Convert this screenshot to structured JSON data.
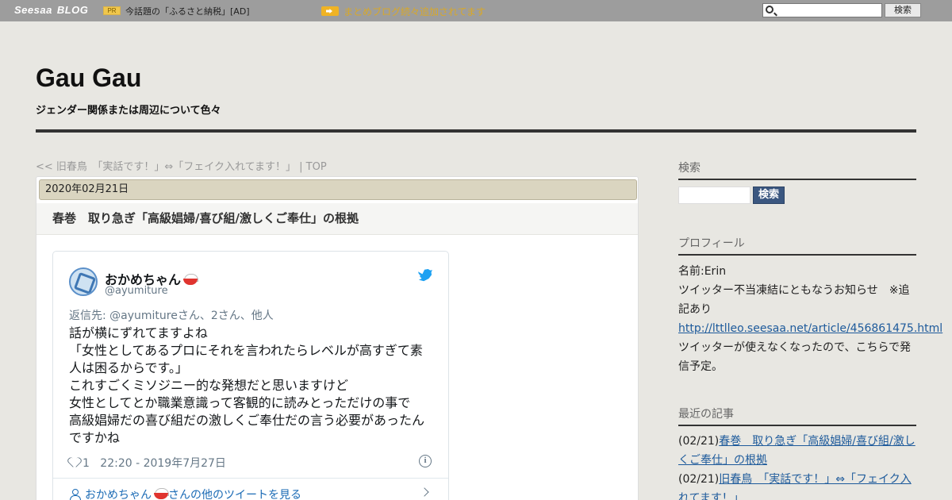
{
  "topbar": {
    "logo_seesaa": "Seesaa",
    "logo_blog": "BLOG",
    "pr_badge": "PR",
    "pr_text": "今話題の「ふるさと納税」[AD]",
    "news_text": "まとめブログ続々追加されてます",
    "search_value": "",
    "search_button": "検索"
  },
  "header": {
    "title": "Gau Gau",
    "description": "ジェンダー関係または周辺について色々"
  },
  "nav": {
    "prev": "<< 旧春鳥　「実話です！」⇔「フェイク入れてます！」",
    "separator": " | ",
    "top": "TOP"
  },
  "article": {
    "date": "2020年02月21日",
    "title": "春巻　取り急ぎ「高級娼婦/喜び組/激しくご奉仕」の根拠"
  },
  "tweet": {
    "user_name": "おかめちゃん",
    "user_handle": "@ayumiture",
    "reply_to": "返信先: @ayumitureさん、2さん、他人",
    "body_lines": [
      "話が横にずれてますよね",
      "「女性としてあるプロにそれを言われたらレベルが高すぎて素",
      "人は困るからです。」",
      "これすごくミソジニー的な発想だと思いますけど",
      "女性としてとか職業意識って客観的に読みとっただけの事で",
      "高級娼婦だの喜び組だの激しくご奉仕だの言う必要があったん",
      "ですかね"
    ],
    "like_count": "1",
    "timestamp": "22:20 - 2019年7月27日",
    "info_glyph": "i",
    "more_link_prefix": "おかめちゃん",
    "more_link_suffix": "さんの他のツイートを見る"
  },
  "sidebar": {
    "search_heading": "検索",
    "search_value": "",
    "search_button": "検索",
    "profile_heading": "プロフィール",
    "profile_name": "名前:Erin",
    "profile_notice": "ツイッター不当凍結にともなうお知らせ　※追記あり",
    "profile_link": "http://lttlleo.seesaa.net/article/456861475.html",
    "profile_note": "ツイッターが使えなくなったので、こちらで発信予定。",
    "recent_heading": "最近の記事",
    "recent_items": [
      {
        "date": "(02/21)",
        "title": "春巻　取り急ぎ「高級娼婦/喜び組/激しくご奉仕」の根拠"
      },
      {
        "date": "(02/21)",
        "title": "旧春鳥　「実話です！」⇔「フェイク入れてます！」"
      }
    ]
  },
  "colors": {
    "background": "#e8e7e2",
    "topbar": "#9d9d9d",
    "date_bar": "#dad5c0",
    "link": "#1d5a9b",
    "twitter_blue": "#1da1f2",
    "search_button": "#3b5780"
  },
  "icons": [
    "search-icon",
    "arrow-right-icon",
    "twitter-bird-icon",
    "heart-icon",
    "info-icon",
    "person-icon",
    "chevron-right-icon",
    "rice-bowl-icon"
  ]
}
